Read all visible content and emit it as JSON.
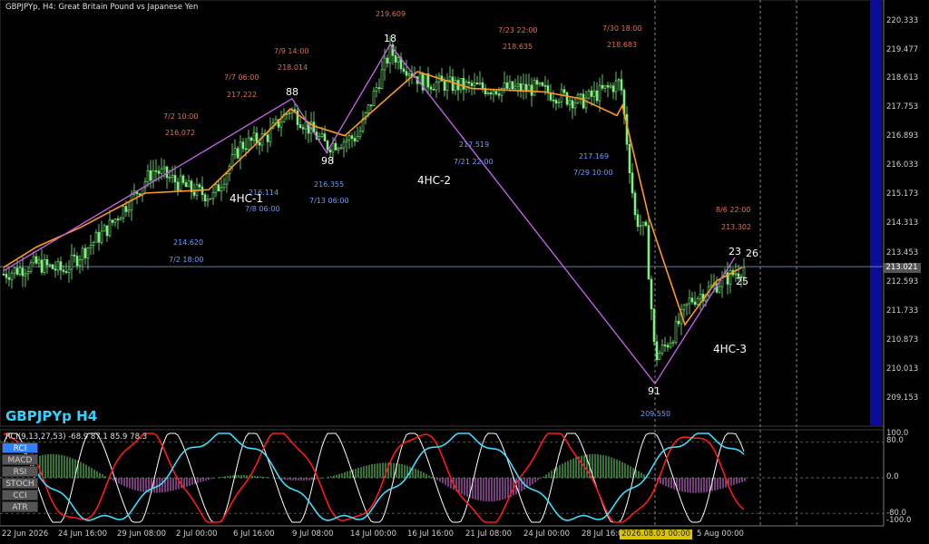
{
  "header": {
    "title": "GBPJPYp, H4:  Great Britain Pound vs Japanese Yen",
    "symbol_watermark": "GBPJPYp H4"
  },
  "price_axis": {
    "labels": [
      "220.333",
      "219.477",
      "218.613",
      "217.753",
      "216.893",
      "216.033",
      "215.173",
      "214.313",
      "213.453",
      "212.593",
      "211.733",
      "210.873",
      "210.013",
      "209.153"
    ],
    "current_price": "213.021"
  },
  "time_axis": {
    "labels": [
      "22 Jun 2026",
      "24 Jun 16:00",
      "29 Jun 08:00",
      "2 Jul 00:00",
      "6 Jul 16:00",
      "9 Jul 08:00",
      "14 Jul 00:00",
      "16 Jul 16:00",
      "21 Jul 08:00",
      "24 Jul 00:00",
      "28 Jul 16:00",
      "5 Aug 00:00"
    ],
    "highlight": "2026.08.03 00:00"
  },
  "annotations": {
    "highs": [
      {
        "time": "7/2 10:00",
        "price": "216.072"
      },
      {
        "time": "7/7 06:00",
        "price": "217.222"
      },
      {
        "time": "7/9 14:00",
        "price": "218.014"
      },
      {
        "time": "",
        "price": "219.609"
      },
      {
        "time": "7/23 22:00",
        "price": "218.635"
      },
      {
        "time": "7/30 18:00",
        "price": "218.683"
      },
      {
        "time": "8/6 22:00",
        "price": "213.302"
      }
    ],
    "lows": [
      {
        "time": "7/2 18:00",
        "price": "214.620"
      },
      {
        "time": "7/8 06:00",
        "price": "216.114"
      },
      {
        "time": "7/13 06:00",
        "price": "216.355"
      },
      {
        "time": "7/21 22:00",
        "price": "217.519"
      },
      {
        "time": "7/29 10:00",
        "price": "217.169"
      },
      {
        "time": "",
        "price": "209.550"
      }
    ],
    "pivots": [
      "88",
      "98",
      "18",
      "91",
      "23",
      "26",
      "25"
    ],
    "waves": [
      "4HC-1",
      "4HC-2",
      "4HC-3"
    ]
  },
  "oscillator": {
    "label": "RCI(9,13,27,53) -68.9 87.1 85.9 78.3",
    "buttons": [
      "RCI",
      "MACD",
      "RSI",
      "STOCH",
      "CCI",
      "ATR"
    ],
    "active": "RCI",
    "levels": [
      "100.0",
      "80.0",
      "0.0",
      "-80.0",
      "-100.0"
    ]
  },
  "colors": {
    "background": "#000000",
    "bull": "#7ff07f",
    "ma": "#ff9a1f",
    "zigzag": "#c05fe0",
    "rci_fast": "#ffffff",
    "rci_mid": "#ff1a1a",
    "rci_slow": "#3fdcff"
  },
  "chart_data": {
    "type": "line",
    "title": "GBPJPYp, H4:  Great Britain Pound vs Japanese Yen",
    "ylim": [
      208.7,
      220.7
    ],
    "zigzag": [
      {
        "x": "22 Jun",
        "y": 212.9
      },
      {
        "x": "9 Jul 06:00",
        "y": 218.0
      },
      {
        "x": "13 Jul 06:00",
        "y": 216.4
      },
      {
        "x": "15 Jul",
        "y": 219.6
      },
      {
        "x": "3 Aug",
        "y": 209.55
      },
      {
        "x": "6 Aug 22:00",
        "y": 213.3
      }
    ],
    "moving_average_levels": [
      213.0,
      213.6,
      214.2,
      215.2,
      215.3,
      216.6,
      217.7,
      217.2,
      216.9,
      218.8,
      218.3,
      218.2,
      218.0,
      217.5,
      217.8,
      214.5,
      211.3,
      212.6,
      213.0
    ],
    "current_price": 213.021
  }
}
